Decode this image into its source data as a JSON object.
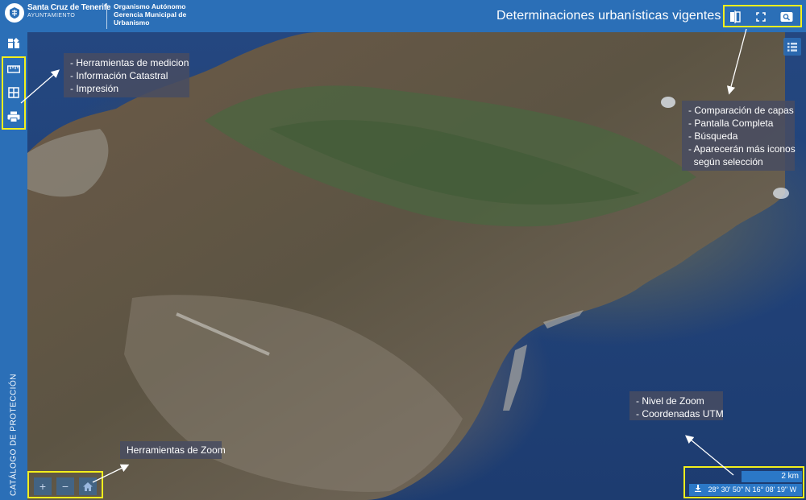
{
  "header": {
    "brand_name": "Santa Cruz de Tenerife",
    "brand_subtitle": "AYUNTAMIENTO",
    "org_line1": "Organismo Autónomo",
    "org_line2": "Gerencia Municipal de",
    "org_line3": "Urbanismo",
    "page_title": "Determinaciones urbanísticas vigentes",
    "tools": [
      {
        "icon": "compare-layers-icon",
        "label": "Comparación de capas"
      },
      {
        "icon": "fullscreen-icon",
        "label": "Pantalla Completa"
      },
      {
        "icon": "search-icon",
        "label": "Búsqueda"
      }
    ]
  },
  "sidebar": {
    "items": [
      {
        "icon": "layers-add-icon"
      },
      {
        "icon": "ruler-icon"
      },
      {
        "icon": "cadastral-grid-icon"
      },
      {
        "icon": "print-icon"
      }
    ],
    "catalog_label": "CATÁLOGO DE PROTECCIÓN"
  },
  "callouts": {
    "left": [
      "- Herramientas de medicion",
      "- Información Catastral",
      "- Impresión"
    ],
    "right": [
      "- Comparación de capas",
      "- Pantalla Completa",
      "- Búsqueda",
      "- Aparecerán más iconos",
      "  según selección"
    ],
    "zoom_info": [
      "- Nivel de Zoom",
      "- Coordenadas UTM"
    ],
    "zoom_tools": "Herramientas de Zoom"
  },
  "zoom_controls": [
    {
      "icon": "zoom-in-icon",
      "glyph": "+"
    },
    {
      "icon": "zoom-out-icon",
      "glyph": "−"
    },
    {
      "icon": "home-icon"
    }
  ],
  "map_status": {
    "scale_label": "2 km",
    "coordinates": "28° 30' 50\" N 16° 08' 19\" W"
  },
  "colors": {
    "primary": "#2b6fb7",
    "highlight": "#f3ef1c",
    "callout_bg": "#484c62",
    "sea": "#1d3c70"
  }
}
